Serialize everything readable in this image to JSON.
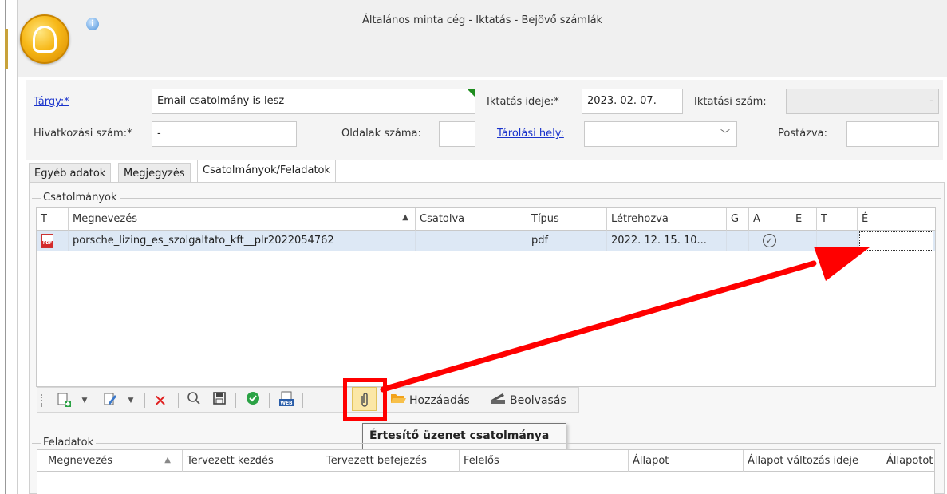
{
  "window": {
    "title": "Általános minta cég - Iktatás - Bejövő számlák"
  },
  "form": {
    "targy_label": "Tárgy:*",
    "targy_value": "Email csatolmány is lesz",
    "iktatas_ideje_label": "Iktatás ideje:*",
    "iktatas_ideje_value": "2023. 02. 07.",
    "iktatasi_szam_label": "Iktatási szám:",
    "iktatasi_szam_value": "-",
    "hivatkozasi_szam_label": "Hivatkozási szám:*",
    "hivatkozasi_szam_value": "-",
    "oldalak_szama_label": "Oldalak száma:",
    "oldalak_szama_value": "",
    "tarolasi_hely_label": "Tárolási hely:",
    "tarolasi_hely_value": "",
    "postazva_label": "Postázva:",
    "postazva_value": ""
  },
  "tabs": [
    {
      "label": "Egyéb adatok"
    },
    {
      "label": "Megjegyzés"
    },
    {
      "label": "Csatolmányok/Feladatok",
      "active": true
    }
  ],
  "attachments": {
    "group_title": "Csatolmányok",
    "columns": [
      "T",
      "Megnevezés",
      "Csatolva",
      "Típus",
      "Létrehozva",
      "G",
      "A",
      "E",
      "T",
      "É"
    ],
    "sort_indicator": "▲",
    "rows": [
      {
        "type_icon": "pdf-file-icon",
        "name": "porsche_lizing_es_szolgaltato_kft__plr2022054762",
        "attached": "",
        "file_type": "pdf",
        "created": "2022. 12. 15. 10...",
        "g": "",
        "a_icon": "check-circle-icon",
        "e": "",
        "t": "",
        "e2": ""
      }
    ]
  },
  "toolbar": {
    "add_label": "Hozzáadás",
    "scan_label": "Beolvasás",
    "icons": [
      "new-document-icon",
      "dropdown-arrow-icon",
      "edit-document-icon",
      "dropdown-arrow-icon",
      "delete-icon",
      "search-icon",
      "save-icon",
      "approve-icon",
      "web-icon",
      "paperclip-icon",
      "folder-icon",
      "scanner-icon"
    ]
  },
  "tooltip": {
    "text": "Értesítő üzenet csatolmánya"
  },
  "tasks": {
    "group_title": "Feladatok",
    "columns": [
      "Megnevezés",
      "Tervezett kezdés",
      "Tervezett befejezés",
      "Felelős",
      "Állapot",
      "Állapot változás ideje",
      "Állapotot"
    ],
    "sort_indicator": "▲"
  },
  "colors": {
    "annotation_red": "#ff0000",
    "link_blue": "#1a33cc",
    "selected_row": "#dde8f5",
    "highlight_button": "#fbe7a6"
  }
}
